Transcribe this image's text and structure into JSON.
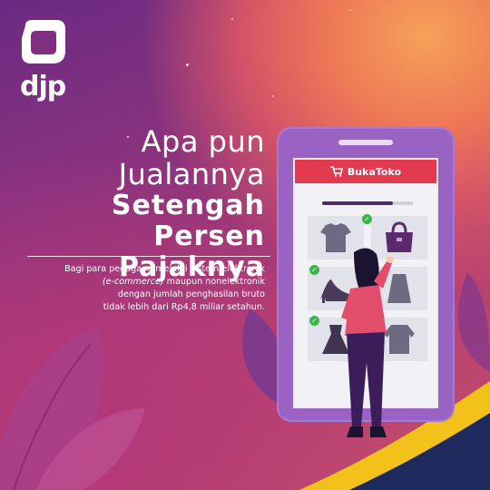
{
  "logo": {
    "text": "djp"
  },
  "headline": {
    "line1": "Apa pun",
    "line2": "Jualannya",
    "line3": "Setengah Persen",
    "line4": "Pajaknya"
  },
  "description": {
    "part1": "Bagi para pedagang melalui sistem elektronik",
    "italic": "(e-commerce)",
    "part2": "maupun nonelektronik",
    "part3": "dengan jumlah penghasilan bruto",
    "part4": "tidak lebih dari Rp4,8 miliar setahun."
  },
  "phone_app": {
    "name": "BukaToko",
    "progress": 0.78,
    "tiles": [
      {
        "item": "t-shirt-icon",
        "checked": false
      },
      {
        "item": "handbag-icon",
        "checked": true
      },
      {
        "item": "high-heel-icon",
        "checked": true
      },
      {
        "item": "skirt-icon",
        "checked": false
      },
      {
        "item": "dress-icon",
        "checked": true
      },
      {
        "item": "sweater-icon",
        "checked": false
      }
    ]
  },
  "colors": {
    "app_bar": "#e23a4f",
    "phone": "#9a62c2",
    "accent_yellow": "#f2c21a",
    "navy": "#1e2a5e"
  }
}
